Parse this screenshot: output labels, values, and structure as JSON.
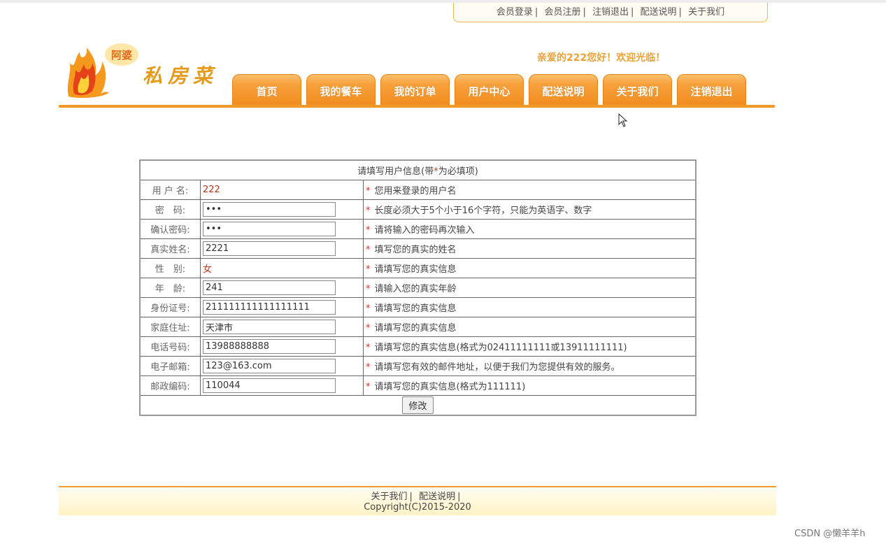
{
  "top_links": [
    "会员登录",
    "会员注册",
    "注销退出",
    "配送说明",
    "关于我们"
  ],
  "separator": "|",
  "brand": {
    "badge": "阿婆",
    "name": "私房菜"
  },
  "welcome": "亲爱的222您好！欢迎光临！",
  "nav_tabs": [
    "首页",
    "我的餐车",
    "我的订单",
    "用户中心",
    "配送说明",
    "关于我们",
    "注销退出"
  ],
  "form": {
    "title_prefix": "请填写用户信息(带",
    "title_star": "*",
    "title_suffix": "为必填项)",
    "star": "*",
    "rows": [
      {
        "label": "用 户 名:",
        "value": "222",
        "hint": "您用来登录的用户名"
      },
      {
        "label": "密　码:",
        "value": "•••",
        "hint": "长度必须大于5个小于16个字符，只能为英语字、数字"
      },
      {
        "label": "确认密码:",
        "value": "•••",
        "hint": "请将输入的密码再次输入"
      },
      {
        "label": "真实姓名:",
        "value": "2221",
        "hint": "填写您的真实的姓名"
      },
      {
        "label": "性　别:",
        "value": "女",
        "hint": "请填写您的真实信息"
      },
      {
        "label": "年　龄:",
        "value": "241",
        "hint": "请输入您的真实年龄"
      },
      {
        "label": "身份证号:",
        "value": "211111111111111111",
        "hint": "请填写您的真实信息"
      },
      {
        "label": "家庭住址:",
        "value": "天津市",
        "hint": "请填写您的真实信息"
      },
      {
        "label": "电话号码:",
        "value": "13988888888",
        "hint": "请填写您的真实信息(格式为02411111111或13911111111)"
      },
      {
        "label": "电子邮箱:",
        "value": "123@163.com",
        "hint": "请填写您有效的邮件地址，以便于我们为您提供有效的服务。"
      },
      {
        "label": "邮政编码:",
        "value": "110044",
        "hint": "请填写您的真实信息(格式为111111)"
      }
    ],
    "submit_label": "修改"
  },
  "footer": {
    "links": [
      "关于我们",
      "配送说明"
    ],
    "copyright": "Copyright(C)2015-2020"
  },
  "watermark": "CSDN @懒羊羊h",
  "colors": {
    "accent": "#f39a2d",
    "welcome": "#e8a23a",
    "star": "#d9341e"
  }
}
